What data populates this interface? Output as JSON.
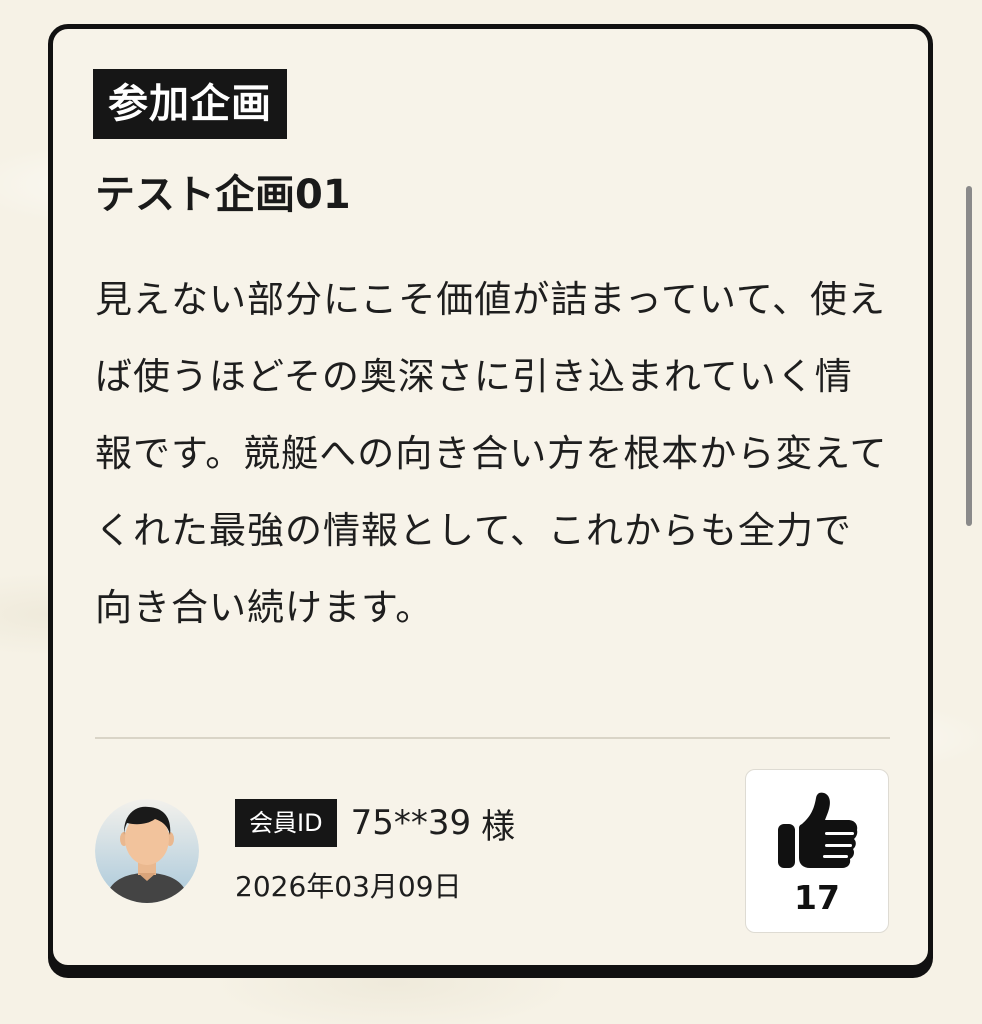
{
  "card": {
    "category_badge": "参加企画",
    "title": "テスト企画01",
    "body": "見えない部分にこそ価値が詰まっていて、使えば使うほどその奥深さに引き込まれていく情報です。競艇への向き合い方を根本から変えてくれた最強の情報として、これからも全力で向き合い続けます。"
  },
  "member": {
    "label": "会員ID",
    "id": "75**39",
    "suffix": "様",
    "date": "2026年03月09日"
  },
  "like": {
    "count": "17",
    "icon": "thumbs-up-icon"
  },
  "colors": {
    "background": "#f6f2e6",
    "card": "#f7f3e9",
    "border": "#111111",
    "badge": "#161616"
  }
}
